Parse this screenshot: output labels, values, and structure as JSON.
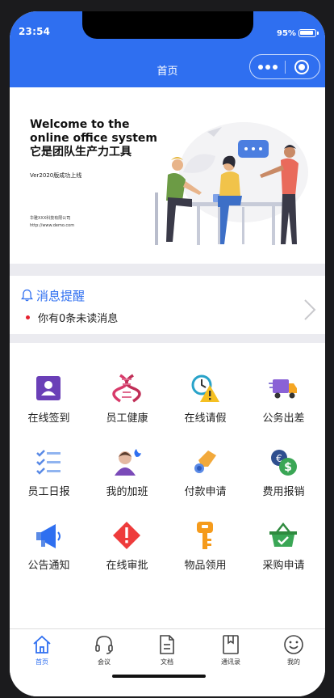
{
  "status": {
    "time": "23:54",
    "battery_percent": "95%",
    "battery_level": 0.95
  },
  "navbar": {
    "title": "首页"
  },
  "banner": {
    "line1": "Welcome to the",
    "line2": "online office system",
    "line3": "它是团队生产力工具",
    "subtitle": "Ver2020版成功上线",
    "company": "华雅XXX科技有限公司",
    "url": "http://www.demo.com"
  },
  "notice": {
    "title": "消息提醒",
    "text": "你有0条未读消息"
  },
  "grid": [
    {
      "label": "在线签到",
      "icon": "id-card-icon"
    },
    {
      "label": "员工健康",
      "icon": "dna-icon"
    },
    {
      "label": "在线请假",
      "icon": "clock-warning-icon"
    },
    {
      "label": "公务出差",
      "icon": "truck-icon"
    },
    {
      "label": "员工日报",
      "icon": "checklist-icon"
    },
    {
      "label": "我的加班",
      "icon": "night-worker-icon"
    },
    {
      "label": "付款申请",
      "icon": "hand-coin-icon"
    },
    {
      "label": "费用报销",
      "icon": "money-icon"
    },
    {
      "label": "公告通知",
      "icon": "megaphone-icon"
    },
    {
      "label": "在线审批",
      "icon": "alert-icon"
    },
    {
      "label": "物品领用",
      "icon": "key-icon"
    },
    {
      "label": "采购申请",
      "icon": "basket-icon"
    }
  ],
  "tabs": [
    {
      "label": "首页",
      "icon": "home-icon",
      "active": true
    },
    {
      "label": "会议",
      "icon": "headset-icon",
      "active": false
    },
    {
      "label": "文档",
      "icon": "document-icon",
      "active": false
    },
    {
      "label": "通讯录",
      "icon": "bookmark-icon",
      "active": false
    },
    {
      "label": "我的",
      "icon": "smiley-icon",
      "active": false
    }
  ],
  "colors": {
    "primary": "#2f6ff0",
    "separator": "#ebebf0",
    "alert_dot": "#e5202e"
  }
}
